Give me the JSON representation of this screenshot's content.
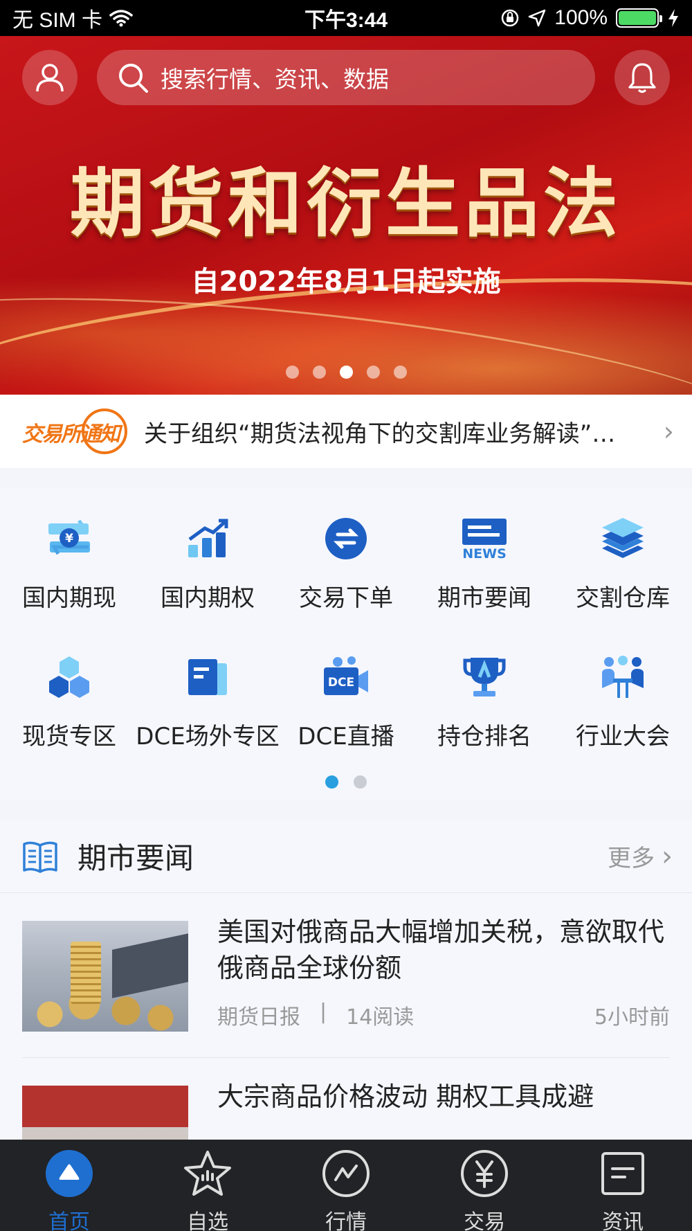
{
  "status_bar": {
    "carrier": "无 SIM 卡",
    "time": "下午3:44",
    "battery": "100%"
  },
  "header": {
    "search_placeholder": "搜索行情、资讯、数据"
  },
  "banner": {
    "title": "期货和衍生品法",
    "subtitle": "自2022年8月1日起实施",
    "page_count": 5,
    "active_page": 3
  },
  "notice": {
    "logo_text": "交易所通知",
    "text": "关于组织“期货法视角下的交割库业务解读”…"
  },
  "shortcuts": {
    "items": [
      {
        "label": "国内期现",
        "icon": "exchange-yuan-icon"
      },
      {
        "label": "国内期权",
        "icon": "bar-chart-up-icon"
      },
      {
        "label": "交易下单",
        "icon": "swap-circle-icon"
      },
      {
        "label": "期市要闻",
        "icon": "news-icon"
      },
      {
        "label": "交割仓库",
        "icon": "layers-icon"
      },
      {
        "label": "现货专区",
        "icon": "cubes-icon"
      },
      {
        "label": "DCE场外专区",
        "icon": "document-icon"
      },
      {
        "label": "DCE直播",
        "icon": "video-camera-icon"
      },
      {
        "label": "持仓排名",
        "icon": "trophy-icon"
      },
      {
        "label": "行业大会",
        "icon": "meeting-icon"
      }
    ],
    "page_count": 2,
    "active_page": 1
  },
  "news": {
    "section_title": "期市要闻",
    "more_label": "更多",
    "items": [
      {
        "title": "美国对俄商品大幅增加关税，意欲取代俄商品全球份额",
        "source": "期货日报",
        "separator": "|",
        "reads": "14阅读",
        "time": "5小时前"
      },
      {
        "title": "大宗商品价格波动 期权工具成避"
      }
    ]
  },
  "tabbar": {
    "tabs": [
      {
        "label": "首页",
        "icon": "home-icon",
        "active": true
      },
      {
        "label": "自选",
        "icon": "star-icon"
      },
      {
        "label": "行情",
        "icon": "market-trend-icon"
      },
      {
        "label": "交易",
        "icon": "yuan-circle-icon"
      },
      {
        "label": "资讯",
        "icon": "news-doc-icon"
      }
    ]
  },
  "colors": {
    "accent": "#1f6fd1",
    "banner_red": "#c8161a",
    "notice_orange": "#f07515"
  }
}
